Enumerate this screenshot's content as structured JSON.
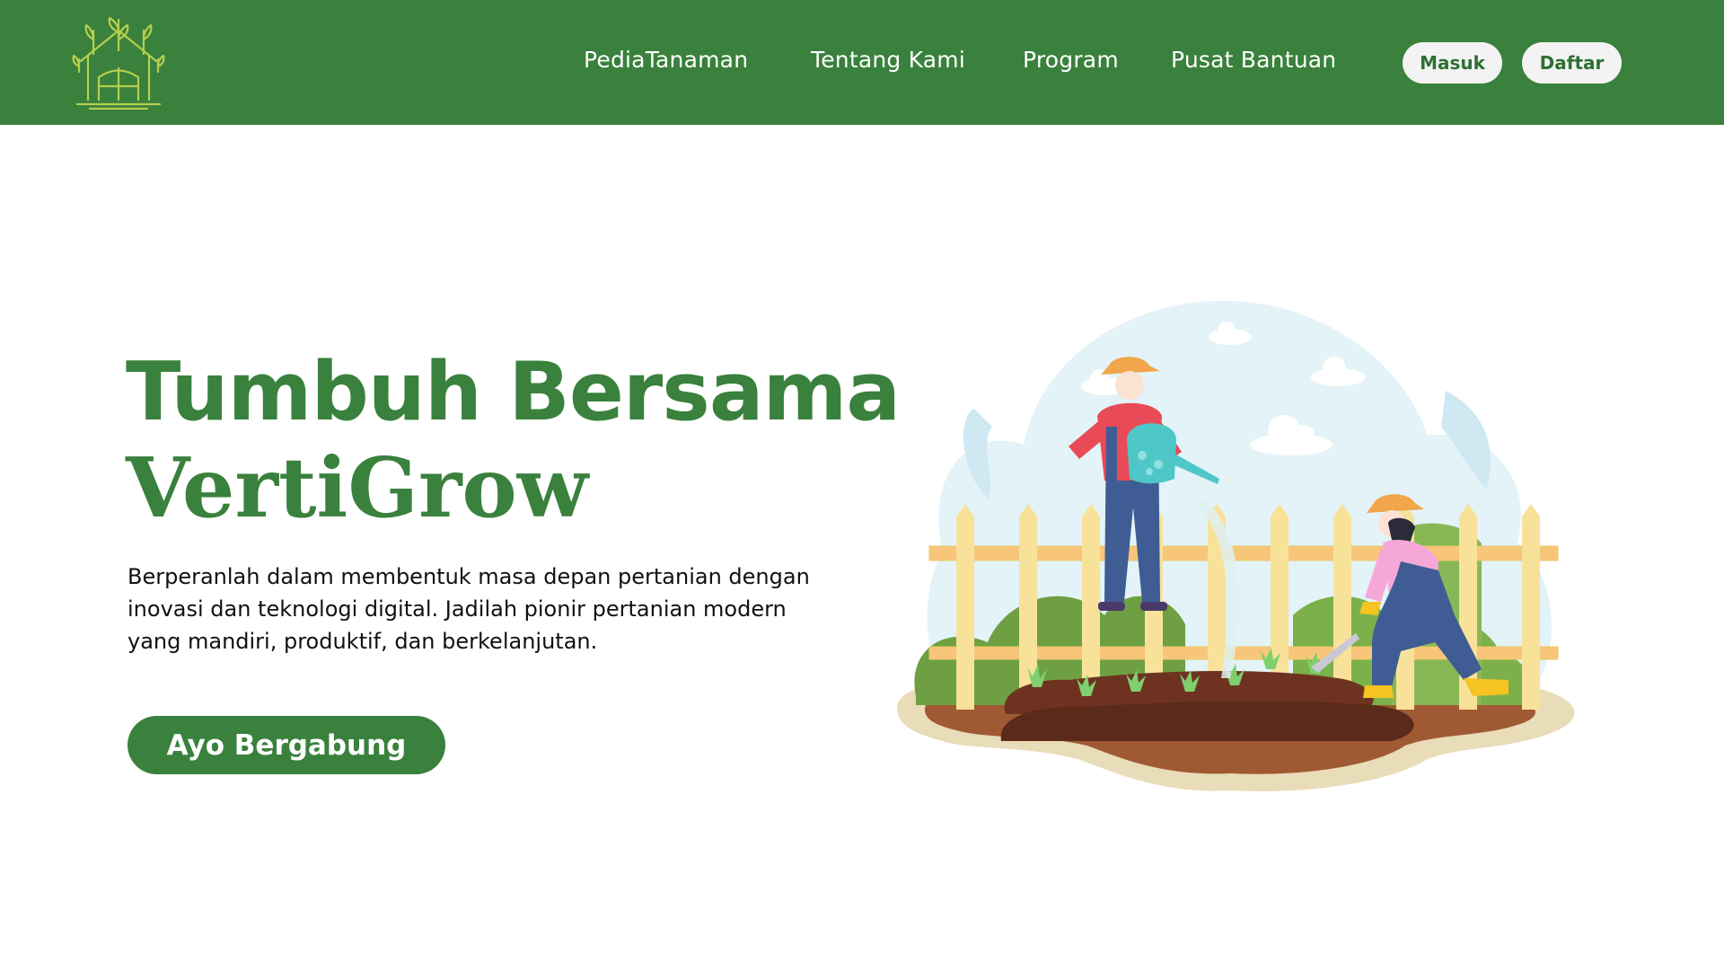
{
  "nav": {
    "links": [
      "PediaTanaman",
      "Tentang Kami",
      "Program",
      "Pusat Bantuan"
    ],
    "login_label": "Masuk",
    "register_label": "Daftar"
  },
  "hero": {
    "title_line1": "Tumbuh Bersama",
    "title_line2": "VertiGrow",
    "description": "Berperanlah dalam membentuk masa depan pertanian dengan inovasi dan teknologi digital. Jadilah pionir pertanian modern yang mandiri, produktif, dan berkelanjutan.",
    "cta_label": "Ayo Bergabung"
  },
  "colors": {
    "brand_green": "#39813c",
    "button_bg": "#f3f3f3",
    "button_text": "#2f6f33"
  },
  "icons": {
    "logo": "greenhouse-leaves-logo",
    "illustration": "farmers-garden-illustration"
  }
}
